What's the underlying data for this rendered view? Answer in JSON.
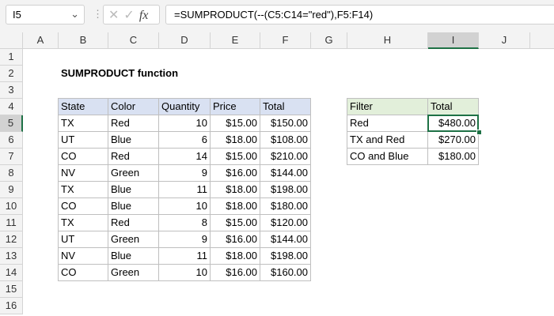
{
  "name_box": "I5",
  "formula": "=SUMPRODUCT(--(C5:C14=\"red\"),F5:F14)",
  "icons": {
    "cancel": "close-icon",
    "enter": "check-icon",
    "fx": "function-icon"
  },
  "columns": [
    "A",
    "B",
    "C",
    "D",
    "E",
    "F",
    "G",
    "H",
    "I",
    "J"
  ],
  "rows": [
    "1",
    "2",
    "3",
    "4",
    "5",
    "6",
    "7",
    "8",
    "9",
    "10",
    "11",
    "12",
    "13",
    "14",
    "15",
    "16"
  ],
  "title": "SUMPRODUCT function",
  "data_table": {
    "headers": [
      "State",
      "Color",
      "Quantity",
      "Price",
      "Total"
    ],
    "rows": [
      [
        "TX",
        "Red",
        "10",
        "$15.00",
        "$150.00"
      ],
      [
        "UT",
        "Blue",
        "6",
        "$18.00",
        "$108.00"
      ],
      [
        "CO",
        "Red",
        "14",
        "$15.00",
        "$210.00"
      ],
      [
        "NV",
        "Green",
        "9",
        "$16.00",
        "$144.00"
      ],
      [
        "TX",
        "Blue",
        "11",
        "$18.00",
        "$198.00"
      ],
      [
        "CO",
        "Blue",
        "10",
        "$18.00",
        "$180.00"
      ],
      [
        "TX",
        "Red",
        "8",
        "$15.00",
        "$120.00"
      ],
      [
        "UT",
        "Green",
        "9",
        "$16.00",
        "$144.00"
      ],
      [
        "NV",
        "Blue",
        "11",
        "$18.00",
        "$198.00"
      ],
      [
        "CO",
        "Green",
        "10",
        "$16.00",
        "$160.00"
      ]
    ]
  },
  "summary_table": {
    "headers": [
      "Filter",
      "Total"
    ],
    "rows": [
      [
        "Red",
        "$480.00"
      ],
      [
        "TX and Red",
        "$270.00"
      ],
      [
        "CO and Blue",
        "$180.00"
      ]
    ]
  },
  "colors": {
    "accent": "#1e7145",
    "header_blue": "#d9e1f2",
    "header_green": "#e2efda"
  }
}
